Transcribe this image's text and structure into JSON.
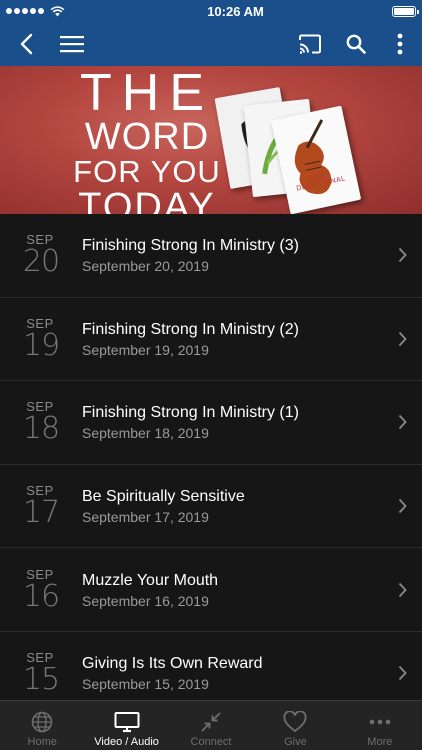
{
  "status_bar": {
    "time": "10:26 AM"
  },
  "banner": {
    "line1": "THE",
    "line2": "WORD",
    "line3": "FOR YOU",
    "line4": "TODAY",
    "book_label": "DAILY DEVOTIONAL"
  },
  "list": [
    {
      "month": "SEP",
      "day": "20",
      "title": "Finishing Strong In Ministry (3)",
      "date": "September 20, 2019"
    },
    {
      "month": "SEP",
      "day": "19",
      "title": "Finishing Strong In Ministry (2)",
      "date": "September 19, 2019"
    },
    {
      "month": "SEP",
      "day": "18",
      "title": "Finishing Strong In Ministry (1)",
      "date": "September 18, 2019"
    },
    {
      "month": "SEP",
      "day": "17",
      "title": "Be Spiritually Sensitive",
      "date": "September 17, 2019"
    },
    {
      "month": "SEP",
      "day": "16",
      "title": "Muzzle Your Mouth",
      "date": "September 16, 2019"
    },
    {
      "month": "SEP",
      "day": "15",
      "title": "Giving Is Its Own Reward",
      "date": "September 15, 2019"
    }
  ],
  "tabs": [
    {
      "label": "Home",
      "icon": "globe-icon"
    },
    {
      "label": "Video / Audio",
      "icon": "monitor-icon"
    },
    {
      "label": "Connect",
      "icon": "connect-arrows-icon"
    },
    {
      "label": "Give",
      "icon": "heart-icon"
    },
    {
      "label": "More",
      "icon": "more-dots-icon"
    }
  ],
  "active_tab": "Video / Audio",
  "colors": {
    "nav": "#1b4f8c",
    "background": "#161616",
    "tab_bar": "#242424"
  }
}
